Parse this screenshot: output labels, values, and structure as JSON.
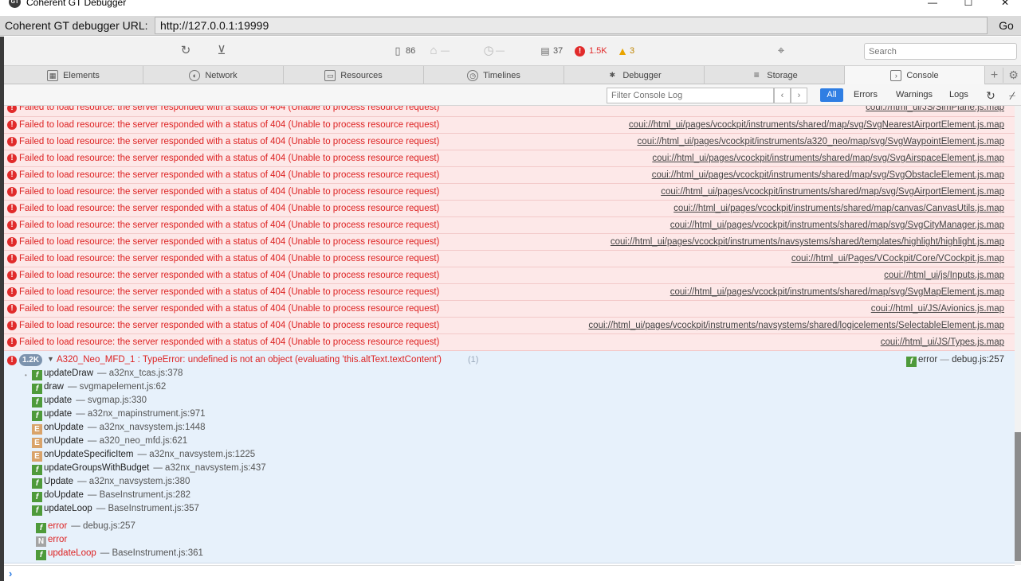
{
  "window": {
    "title": "Coherent GT Debugger",
    "icon_text": "GT",
    "minimize": "—",
    "maximize": "☐",
    "close": "✕"
  },
  "urlbar": {
    "label": "Coherent GT debugger URL:",
    "value": "http://127.0.0.1:19999",
    "go": "Go"
  },
  "toolbar": {
    "reload_icon": "reload-icon",
    "download_icon": "download-icon",
    "resources_count": "86",
    "layout_count": "—",
    "timer_count": "—",
    "messages_count": "37",
    "errors_count": "1.5K",
    "warnings_count": "3",
    "search_placeholder": "Search"
  },
  "tabs": [
    {
      "label": "Elements",
      "icon": "elements-icon",
      "glyph": "▦"
    },
    {
      "label": "Network",
      "icon": "network-icon",
      "glyph": "◐"
    },
    {
      "label": "Resources",
      "icon": "resources-icon",
      "glyph": "▭"
    },
    {
      "label": "Timelines",
      "icon": "timelines-icon",
      "glyph": "◷"
    },
    {
      "label": "Debugger",
      "icon": "debugger-icon",
      "glyph": "✱"
    },
    {
      "label": "Storage",
      "icon": "storage-icon",
      "glyph": "≡"
    },
    {
      "label": "Console",
      "icon": "console-icon",
      "glyph": "›"
    }
  ],
  "console_filter": {
    "placeholder": "Filter Console Log",
    "all": "All",
    "errors": "Errors",
    "warnings": "Warnings",
    "logs": "Logs"
  },
  "log": {
    "message": "Failed to load resource: the server responded with a status of 404 (Unable to process resource request)",
    "first_source": "coui://html_ui/JS/SimPlane.js.map",
    "sources": [
      "coui://html_ui/pages/vcockpit/instruments/shared/map/svg/SvgNearestAirportElement.js.map",
      "coui://html_ui/pages/vcockpit/instruments/a320_neo/map/svg/SvgWaypointElement.js.map",
      "coui://html_ui/pages/vcockpit/instruments/shared/map/svg/SvgAirspaceElement.js.map",
      "coui://html_ui/pages/vcockpit/instruments/shared/map/svg/SvgObstacleElement.js.map",
      "coui://html_ui/pages/vcockpit/instruments/shared/map/svg/SvgAirportElement.js.map",
      "coui://html_ui/pages/vcockpit/instruments/shared/map/canvas/CanvasUtils.js.map",
      "coui://html_ui/pages/vcockpit/instruments/shared/map/svg/SvgCityManager.js.map",
      "coui://html_ui/pages/vcockpit/instruments/navsystems/shared/templates/highlight/highlight.js.map",
      "coui://html_ui/Pages/VCockpit/Core/VCockpit.js.map",
      "coui://html_ui/js/Inputs.js.map",
      "coui://html_ui/pages/vcockpit/instruments/shared/map/svg/SvgMapElement.js.map",
      "coui://html_ui/JS/Avionics.js.map",
      "coui://html_ui/pages/vcockpit/instruments/navsystems/shared/logicelements/SelectableElement.js.map",
      "coui://html_ui/JS/Types.js.map"
    ]
  },
  "expanded_error": {
    "badge": "1.2K",
    "message": "A320_Neo_MFD_1 : TypeError: undefined is not an object (evaluating 'this.altText.textContent')",
    "count": "(1)",
    "source_fn": "error",
    "source_loc": "debug.js:257",
    "frames": [
      {
        "type": "f",
        "name": "updateDraw",
        "loc": "a32nx_tcas.js:378"
      },
      {
        "type": "f",
        "name": "draw",
        "loc": "svgmapelement.js:62"
      },
      {
        "type": "f",
        "name": "update",
        "loc": "svgmap.js:330"
      },
      {
        "type": "f",
        "name": "update",
        "loc": "a32nx_mapinstrument.js:971"
      },
      {
        "type": "E",
        "name": "onUpdate",
        "loc": "a32nx_navsystem.js:1448"
      },
      {
        "type": "E",
        "name": "onUpdate",
        "loc": "a320_neo_mfd.js:621"
      },
      {
        "type": "E",
        "name": "onUpdateSpecificItem",
        "loc": "a32nx_navsystem.js:1225"
      },
      {
        "type": "f",
        "name": "updateGroupsWithBudget",
        "loc": "a32nx_navsystem.js:437"
      },
      {
        "type": "f",
        "name": "Update",
        "loc": "a32nx_navsystem.js:380"
      },
      {
        "type": "f",
        "name": "doUpdate",
        "loc": "BaseInstrument.js:282"
      },
      {
        "type": "f",
        "name": "updateLoop",
        "loc": "BaseInstrument.js:357"
      }
    ],
    "async_frames": [
      {
        "type": "f",
        "name": "error",
        "loc": "debug.js:257"
      },
      {
        "type": "N",
        "name": "error",
        "loc": ""
      },
      {
        "type": "f",
        "name": "updateLoop",
        "loc": "BaseInstrument.js:361"
      }
    ]
  },
  "prompt": "›"
}
